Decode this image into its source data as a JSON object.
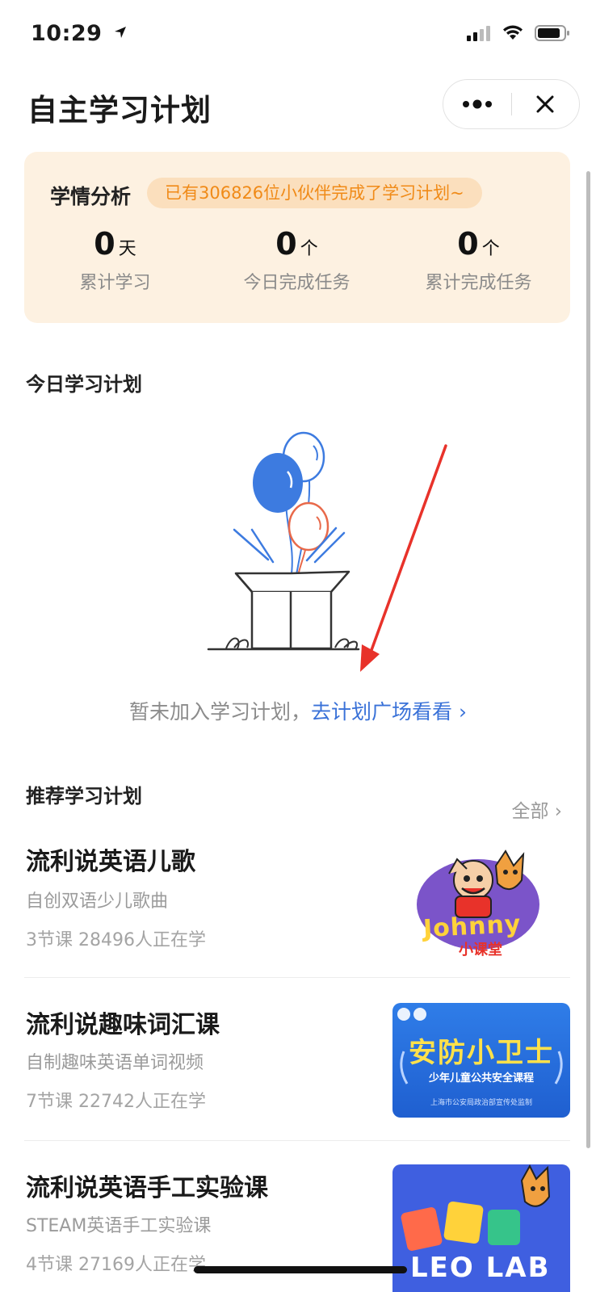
{
  "status_bar": {
    "time": "10:29"
  },
  "header": {
    "title": "自主学习计划"
  },
  "analysis": {
    "title": "学情分析",
    "badge": "已有306826位小伙伴完成了学习计划~",
    "stats": [
      {
        "value": "0",
        "unit": "天",
        "label": "累计学习"
      },
      {
        "value": "0",
        "unit": "个",
        "label": "今日完成任务"
      },
      {
        "value": "0",
        "unit": "个",
        "label": "累计完成任务"
      }
    ]
  },
  "today": {
    "title": "今日学习计划",
    "empty_text": "暂未加入学习计划，",
    "empty_link": "去计划广场看看 ›"
  },
  "recommend": {
    "title": "推荐学习计划",
    "all_label": "全部 ›",
    "courses": [
      {
        "title": "流利说英语儿歌",
        "subtitle": "自创双语少儿歌曲",
        "meta": "3节课 28496人正在学",
        "thumb_text": "Johnny",
        "thumb_sub": "小课堂"
      },
      {
        "title": "流利说趣味词汇课",
        "subtitle": "自制趣味英语单词视频",
        "meta": "7节课 22742人正在学",
        "thumb_text": "安防小卫士",
        "thumb_sub": "少年儿童公共安全课程",
        "thumb_footer": "上海市公安局政治部宣传处监制"
      },
      {
        "title": "流利说英语手工实验课",
        "subtitle": "STEAM英语手工实验课",
        "meta": "4节课 27169人正在学",
        "thumb_text": "LEO LAB"
      }
    ]
  },
  "colors": {
    "accent_orange": "#f08a17",
    "link_blue": "#3a72d8",
    "card_bg": "#fdf1e1"
  }
}
